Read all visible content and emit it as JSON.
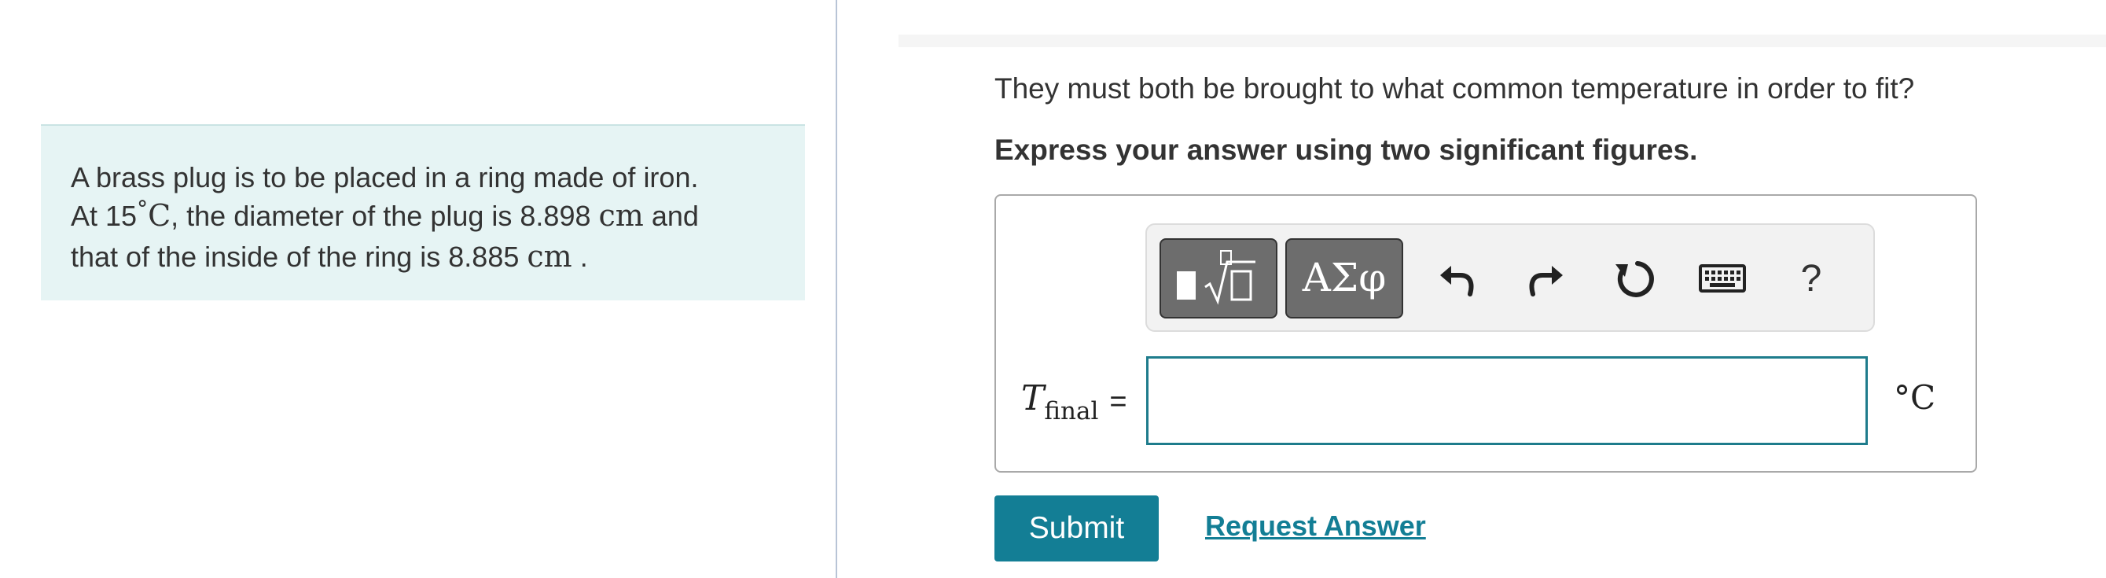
{
  "problem": {
    "line1": "A brass plug is to be placed in a ring made of iron.",
    "line2_prefix": "At 15",
    "degree": "°",
    "unit_c": "C",
    "line2_middle": ", the diameter of the plug is 8.898 ",
    "unit_cm": "cm",
    "line2_suffix": " and",
    "line3_prefix": "that of the inside of the ring is 8.885 ",
    "line3_suffix": " ."
  },
  "question": {
    "prompt": "They must both be brought to what common temperature in order to fit?",
    "instruction": "Express your answer using two significant figures."
  },
  "toolbar": {
    "symbols_label": "ΑΣφ",
    "help_label": "?",
    "icons": [
      "templates-icon",
      "symbols-icon",
      "undo-icon",
      "redo-icon",
      "reset-icon",
      "keyboard-icon",
      "help-icon"
    ]
  },
  "answer": {
    "variable": "T",
    "subscript": "final",
    "equals": "=",
    "value": "",
    "unit": "°C"
  },
  "actions": {
    "submit_label": "Submit",
    "request_label": "Request Answer"
  },
  "colors": {
    "accent": "#137e95",
    "problem_bg": "#e6f4f4",
    "input_border": "#1e7c8c"
  }
}
